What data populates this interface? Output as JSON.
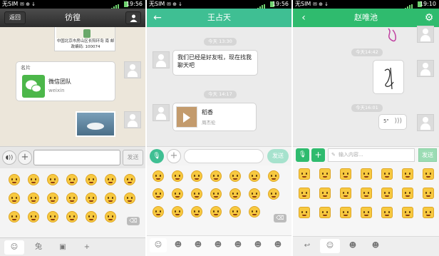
{
  "panel1": {
    "status": {
      "carrier": "无SIM",
      "time": "19:56"
    },
    "title": "彷徨",
    "back_label": "返回",
    "map_address": "中国北京市房山区长阳环岛 南 邮政编码: 100074",
    "card": {
      "label": "名片",
      "name": "微信团队",
      "id": "weixin"
    },
    "send_label": "发送",
    "tabs": [
      "☺",
      "兔",
      "▣",
      "+"
    ]
  },
  "panel2": {
    "status": {
      "carrier": "无SIM",
      "time": "19:56"
    },
    "title": "王占天",
    "timestamp1": "今天 13:30",
    "message1": "我们已经是好友啦，现在找我聊天吧",
    "timestamp2": "今天 14:17",
    "music": {
      "title": "稻香",
      "artist": "周杰伦"
    },
    "send_label": "发送"
  },
  "panel3": {
    "status": {
      "carrier": "无SIM",
      "time": "19:10"
    },
    "title": "赵唯池",
    "timestamp1": "今天14:42",
    "timestamp2": "今天16:01",
    "voice_duration": "5\"",
    "input_placeholder": "输入内容...",
    "send_label": "发送"
  },
  "colors": {
    "wechat_bubble_green": "#9fe358",
    "panel2_accent": "#3fbf93",
    "panel3_accent": "#2fbb6e"
  },
  "icons": {
    "panel1": [
      "back-button",
      "contact-icon",
      "voice-icon",
      "plus-icon",
      "delete-icon",
      "emoji-tab-icon",
      "rabbit-tab-icon",
      "image-tab-icon",
      "add-tab-icon"
    ],
    "panel2": [
      "back-arrow-icon",
      "mic-icon",
      "plus-icon",
      "play-icon",
      "delete-icon"
    ],
    "panel3": [
      "back-arrow-icon",
      "gear-icon",
      "mic-icon",
      "plus-icon",
      "pen-icon",
      "voice-wave-icon",
      "return-icon"
    ]
  }
}
